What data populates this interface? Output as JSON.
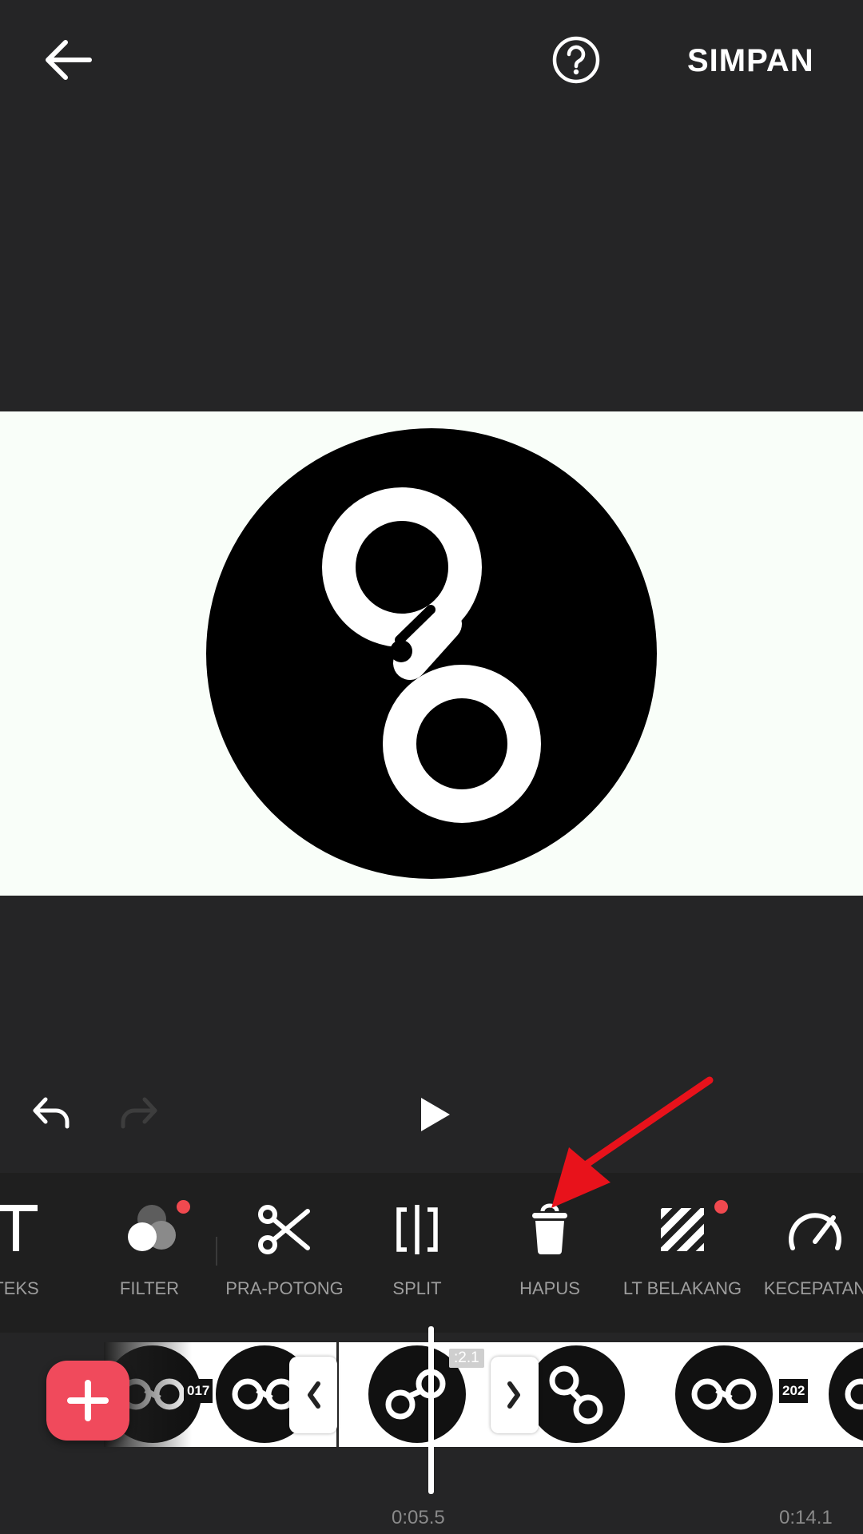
{
  "header": {
    "back_icon": "arrow-left-icon",
    "help_icon": "question-circle-icon",
    "save_label": "SIMPAN"
  },
  "preview": {
    "logo": "circle-logo-infinity-rings"
  },
  "playback": {
    "undo_icon": "undo-icon",
    "redo_icon": "redo-icon",
    "play_icon": "play-icon"
  },
  "toolbar": {
    "items": [
      {
        "label": "TEKS",
        "icon": "text-icon"
      },
      {
        "label": "FILTER",
        "icon": "filter-icon",
        "badge": true
      },
      {
        "label": "PRA-POTONG",
        "icon": "scissors-icon"
      },
      {
        "label": "SPLIT",
        "icon": "split-icon"
      },
      {
        "label": "HAPUS",
        "icon": "trash-icon"
      },
      {
        "label": "LT BELAKANG",
        "icon": "background-stripes-icon",
        "badge": true
      },
      {
        "label": "KECEPATAN",
        "icon": "speedometer-icon"
      }
    ]
  },
  "timeline": {
    "clip_duration": ":2.1",
    "year_left": "017",
    "year_right": "202",
    "current_time": "0:05.5",
    "end_time": "0:14.1",
    "add_icon": "plus-icon"
  },
  "colors": {
    "background": "#252526",
    "toolbar": "#1f1f1f",
    "accent": "#f04a5c",
    "annotation_arrow": "#e8121b"
  }
}
